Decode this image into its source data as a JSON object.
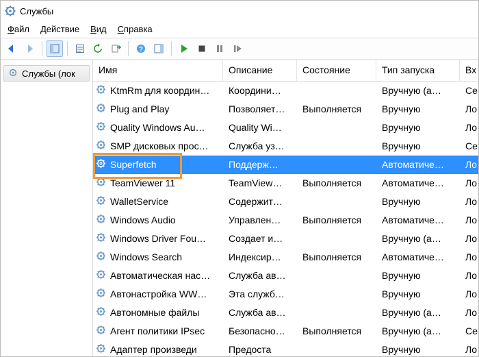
{
  "title": "Службы",
  "menu": {
    "file": {
      "ul": "Ф",
      "rest": "айл"
    },
    "action": {
      "ul": "Д",
      "rest": "ействие"
    },
    "view": {
      "ul": "В",
      "rest": "ид"
    },
    "help": {
      "ul": "С",
      "rest": "правка"
    }
  },
  "tree": {
    "root": "Службы (лок"
  },
  "columns": {
    "name": "Имя",
    "desc": "Описание",
    "status": "Состояние",
    "start": "Тип запуска",
    "logon": "Вх"
  },
  "rows": [
    {
      "name": "KtmRm для координ…",
      "desc": "Координи…",
      "status": "",
      "start": "Вручную (а…",
      "logon": "Се"
    },
    {
      "name": "Plug and Play",
      "desc": "Позволяет…",
      "status": "Выполняется",
      "start": "Вручную",
      "logon": "Ло"
    },
    {
      "name": "Quality Windows Au…",
      "desc": "Quality Wi…",
      "status": "",
      "start": "Вручную",
      "logon": "Ло"
    },
    {
      "name": "SMP дисковых прос…",
      "desc": "Служба уз…",
      "status": "",
      "start": "Вручную",
      "logon": "Се"
    },
    {
      "name": "Superfetch",
      "desc": "Поддерж…",
      "status": "",
      "start": "Автоматиче…",
      "logon": "Ло",
      "selected": true
    },
    {
      "name": "TeamViewer 11",
      "desc": "TeamView…",
      "status": "Выполняется",
      "start": "Автоматиче…",
      "logon": "Ло"
    },
    {
      "name": "WalletService",
      "desc": "Содержит…",
      "status": "",
      "start": "Вручную",
      "logon": "Ло"
    },
    {
      "name": "Windows Audio",
      "desc": "Управлен…",
      "status": "Выполняется",
      "start": "Автоматиче…",
      "logon": "Ло"
    },
    {
      "name": "Windows Driver Fou…",
      "desc": "Создает и…",
      "status": "",
      "start": "Вручную (а…",
      "logon": "Ло"
    },
    {
      "name": "Windows Search",
      "desc": "Индексир…",
      "status": "Выполняется",
      "start": "Автоматиче…",
      "logon": "Ло"
    },
    {
      "name": "Автоматическая нас…",
      "desc": "Служба ав…",
      "status": "",
      "start": "Вручную",
      "logon": "Ло"
    },
    {
      "name": "Автонастройка WW…",
      "desc": "Эта служб…",
      "status": "",
      "start": "Вручную",
      "logon": "Ло"
    },
    {
      "name": "Автономные файлы",
      "desc": "Служба ав…",
      "status": "",
      "start": "Вручную (а…",
      "logon": "Ло"
    },
    {
      "name": "Агент политики IPsec",
      "desc": "Безопасно…",
      "status": "Выполняется",
      "start": "Вручную (а…",
      "logon": "Се"
    },
    {
      "name": "Адаптер произведи",
      "desc": "Предоста",
      "status": "",
      "start": "Вручную",
      "logon": "Ло"
    }
  ]
}
